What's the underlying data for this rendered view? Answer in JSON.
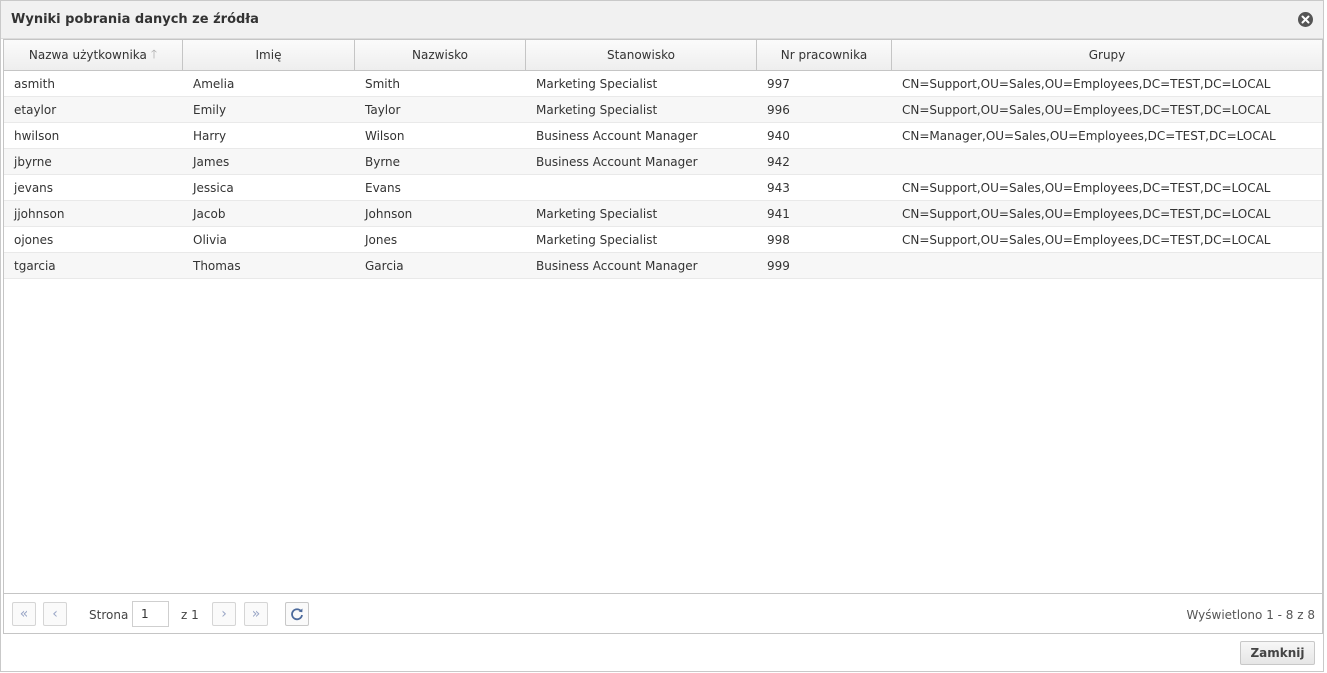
{
  "dialog": {
    "title": "Wyniki pobrania danych ze źródła",
    "close_icon": "close-icon"
  },
  "columns": [
    {
      "label": "Nazwa użytkownika",
      "sorted": "asc"
    },
    {
      "label": "Imię"
    },
    {
      "label": "Nazwisko"
    },
    {
      "label": "Stanowisko"
    },
    {
      "label": "Nr pracownika"
    },
    {
      "label": "Grupy"
    }
  ],
  "rows": [
    [
      "asmith",
      "Amelia",
      "Smith",
      "Marketing Specialist",
      "997",
      "CN=Support,OU=Sales,OU=Employees,DC=TEST,DC=LOCAL"
    ],
    [
      "etaylor",
      "Emily",
      "Taylor",
      "Marketing Specialist",
      "996",
      "CN=Support,OU=Sales,OU=Employees,DC=TEST,DC=LOCAL"
    ],
    [
      "hwilson",
      "Harry",
      "Wilson",
      "Business Account Manager",
      "940",
      "CN=Manager,OU=Sales,OU=Employees,DC=TEST,DC=LOCAL"
    ],
    [
      "jbyrne",
      "James",
      "Byrne",
      "Business Account Manager",
      "942",
      ""
    ],
    [
      "jevans",
      "Jessica",
      "Evans",
      "",
      "943",
      "CN=Support,OU=Sales,OU=Employees,DC=TEST,DC=LOCAL"
    ],
    [
      "jjohnson",
      "Jacob",
      "Johnson",
      "Marketing Specialist",
      "941",
      "CN=Support,OU=Sales,OU=Employees,DC=TEST,DC=LOCAL"
    ],
    [
      "ojones",
      "Olivia",
      "Jones",
      "Marketing Specialist",
      "998",
      "CN=Support,OU=Sales,OU=Employees,DC=TEST,DC=LOCAL"
    ],
    [
      "tgarcia",
      "Thomas",
      "Garcia",
      "Business Account Manager",
      "999",
      ""
    ]
  ],
  "pager": {
    "first_icon": "double-chevron-left-icon",
    "prev_icon": "chevron-left-icon",
    "page_label": "Strona",
    "page_value": "1",
    "of_label": "z 1",
    "next_icon": "chevron-right-icon",
    "last_icon": "double-chevron-right-icon",
    "refresh_icon": "refresh-icon",
    "info": "Wyświetlono 1 - 8 z 8"
  },
  "footer": {
    "close_label": "Zamknij"
  },
  "colors": {
    "header_bg": "#f1f1f1",
    "border": "#c5c5c5",
    "pager_icon": "#9aa6c6"
  }
}
